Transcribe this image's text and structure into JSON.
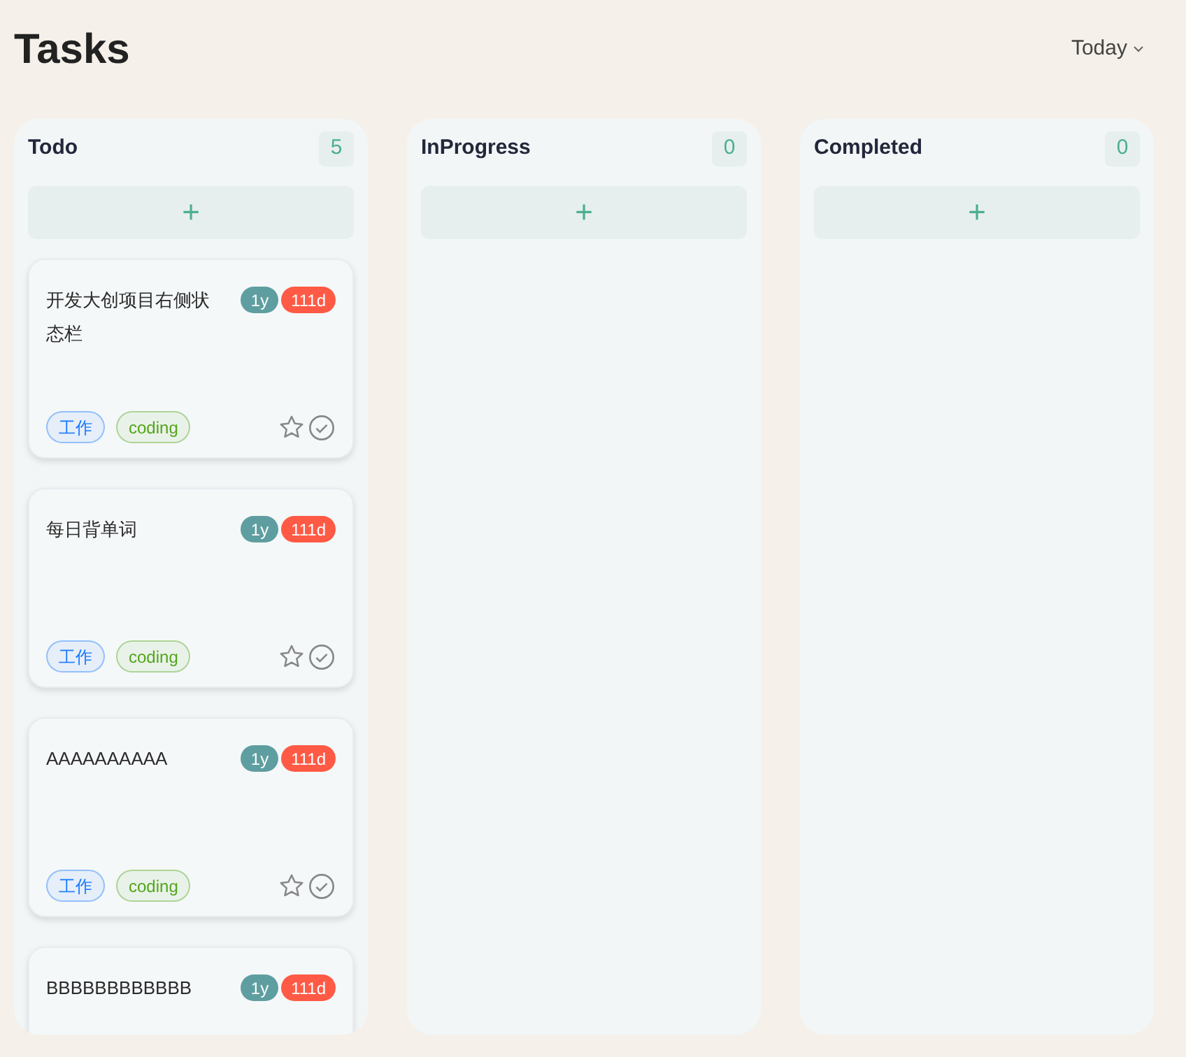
{
  "header": {
    "title": "Tasks",
    "period": "Today"
  },
  "columns": [
    {
      "title": "Todo",
      "count": "5",
      "add": "+",
      "tasks": [
        {
          "title": "开发大创项目右侧状态栏",
          "badges": [
            {
              "text": "1y",
              "color": "#5f9ea0"
            },
            {
              "text": "111d",
              "color": "#ff5a45"
            }
          ],
          "tags": [
            {
              "text": "工作",
              "color": "#1677ff"
            },
            {
              "text": "coding",
              "color": "#52a61a"
            }
          ]
        },
        {
          "title": "每日背单词",
          "badges": [
            {
              "text": "1y",
              "color": "#5f9ea0"
            },
            {
              "text": "111d",
              "color": "#ff5a45"
            }
          ],
          "tags": [
            {
              "text": "工作",
              "color": "#1677ff"
            },
            {
              "text": "coding",
              "color": "#52a61a"
            }
          ]
        },
        {
          "title": "AAAAAAAAAA",
          "badges": [
            {
              "text": "1y",
              "color": "#5f9ea0"
            },
            {
              "text": "111d",
              "color": "#ff5a45"
            }
          ],
          "tags": [
            {
              "text": "工作",
              "color": "#1677ff"
            },
            {
              "text": "coding",
              "color": "#52a61a"
            }
          ]
        },
        {
          "title": "BBBBBBBBBBBB",
          "badges": [
            {
              "text": "1y",
              "color": "#5f9ea0"
            },
            {
              "text": "111d",
              "color": "#ff5a45"
            }
          ]
        }
      ]
    },
    {
      "title": "InProgress",
      "count": "0",
      "add": "+"
    },
    {
      "title": "Completed",
      "count": "0",
      "add": "+"
    }
  ]
}
